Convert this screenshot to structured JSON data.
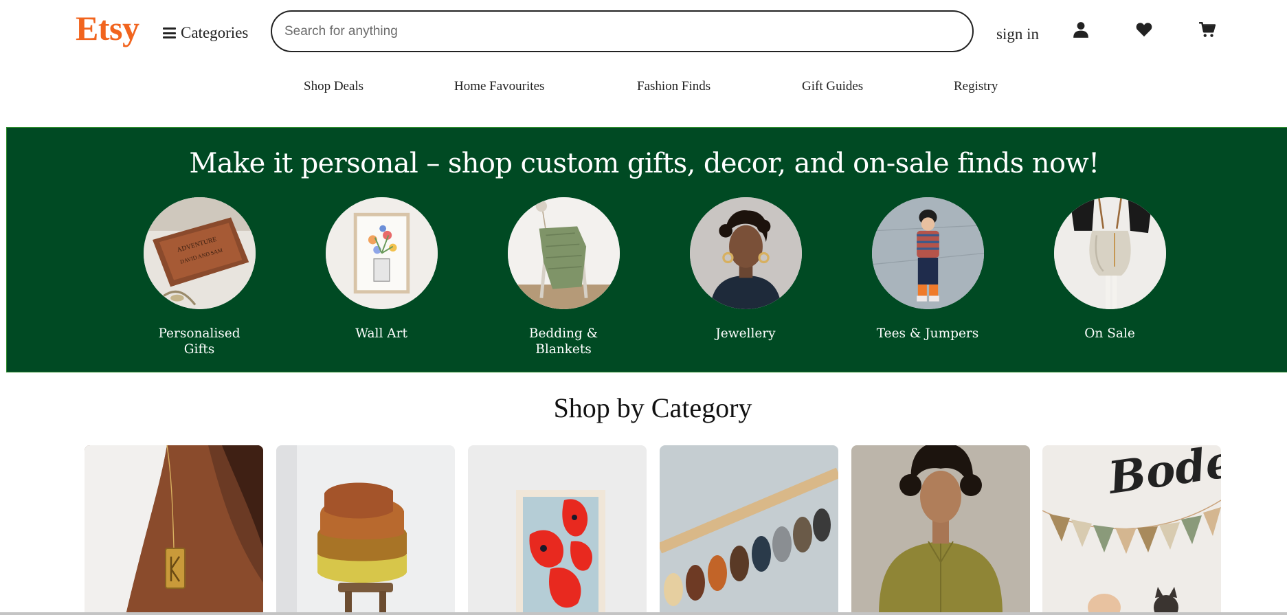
{
  "header": {
    "logo": "Etsy",
    "categories_label": "Categories",
    "search_placeholder": "Search for anything",
    "search_value": "",
    "sign_in_label": "sign in"
  },
  "icons": {
    "menu": "hamburger-icon",
    "account": "user-icon",
    "favorites": "heart-icon",
    "cart": "cart-icon"
  },
  "nav": {
    "links": [
      "Shop Deals",
      "Home Favourites",
      "Fashion Finds",
      "Gift Guides",
      "Registry"
    ]
  },
  "banner": {
    "title": "Make it personal – shop custom gifts, decor, and on-sale finds now!",
    "items": [
      {
        "label": "Personalised Gifts"
      },
      {
        "label": "Wall Art"
      },
      {
        "label": "Bedding & Blankets"
      },
      {
        "label": "Jewellery"
      },
      {
        "label": "Tees & Jumpers"
      },
      {
        "label": "On Sale"
      }
    ]
  },
  "shop_by_category": {
    "title": "Shop by Category",
    "card_count": 6
  },
  "colors": {
    "brand": "#f1641e",
    "banner_bg": "#004a23",
    "banner_border": "#2c8a2c",
    "text": "#222222"
  }
}
